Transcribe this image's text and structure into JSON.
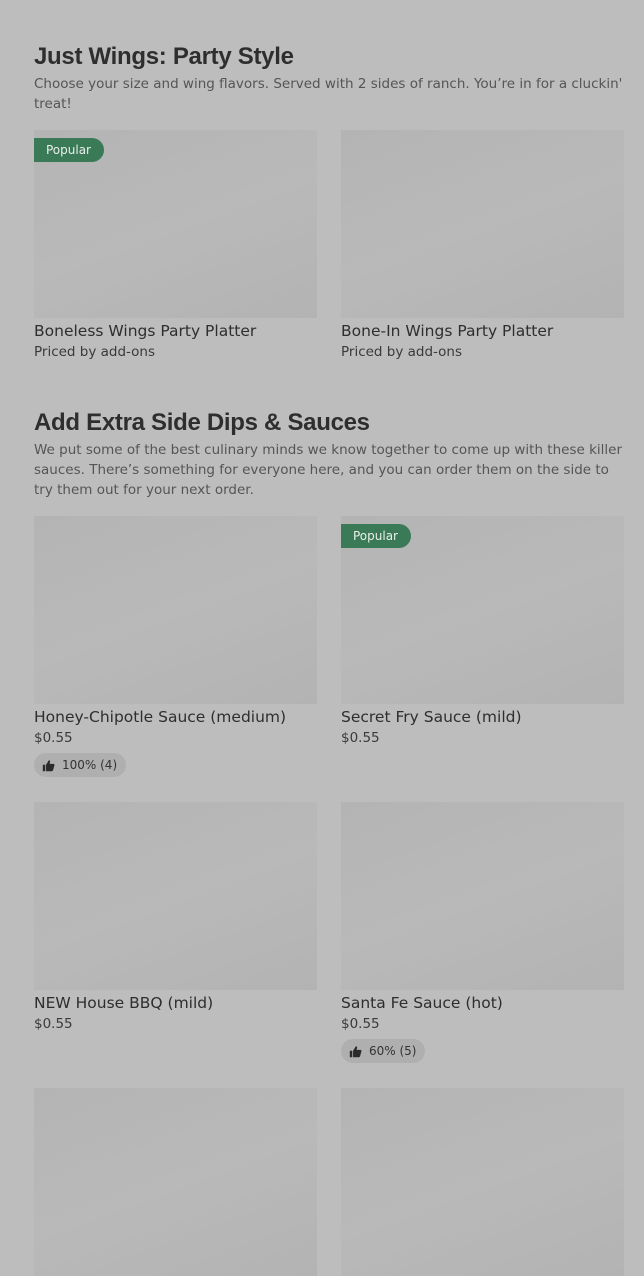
{
  "sections": [
    {
      "title": "Just Wings: Party Style",
      "description": "Choose your size and wing flavors. Served with 2 sides of ranch. You’re in for a cluckin' treat!",
      "items": [
        {
          "name": "Boneless Wings Party Platter",
          "price": "Priced by add-ons",
          "badge": "Popular"
        },
        {
          "name": "Bone-In Wings Party Platter",
          "price": "Priced by add-ons"
        }
      ]
    },
    {
      "title": "Add Extra Side Dips & Sauces",
      "description": "We put some of the best culinary minds we know together to come up with these killer sauces. There’s something for everyone here, and you can order them on the side to try them out for your next order.",
      "items": [
        {
          "name": "Honey-Chipotle Sauce (medium)",
          "price": "$0.55",
          "rating": "100% (4)"
        },
        {
          "name": "Secret Fry Sauce (mild)",
          "price": "$0.55",
          "badge": "Popular"
        },
        {
          "name": "NEW House BBQ (mild)",
          "price": "$0.55"
        },
        {
          "name": "Santa Fe Sauce (hot)",
          "price": "$0.55",
          "rating": "60% (5)"
        }
      ]
    }
  ],
  "icons": {
    "rating": "thumbs-up-icon"
  },
  "colors": {
    "background": "#bdbdbd",
    "badge": "#3b7a57",
    "rating_pill": "#afafaf"
  }
}
